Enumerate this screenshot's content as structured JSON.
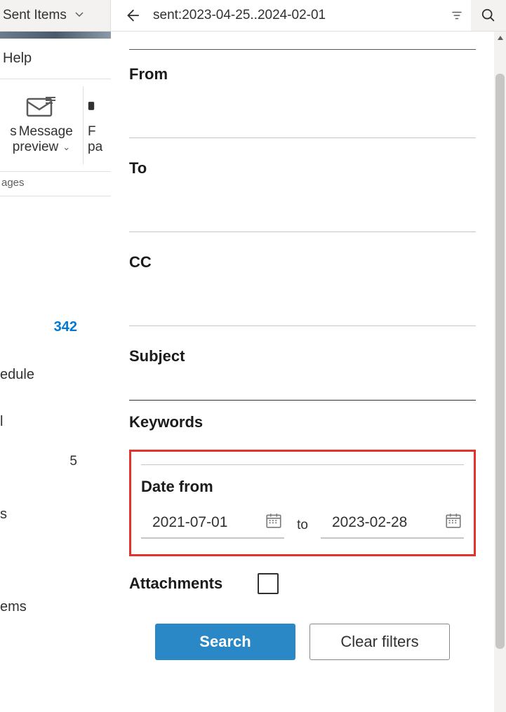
{
  "topbar": {
    "folder_label": "Sent Items",
    "search_query": "sent:2023-04-25..2024-02-01"
  },
  "help_label": "Help",
  "ribbon": {
    "msg_preview_prefix": "s",
    "msg_preview_line1": "Message",
    "msg_preview_line2": "preview",
    "folder_pane_prefix": "F",
    "folder_pane_line2": "pa",
    "group_label": "ages"
  },
  "left_items": {
    "count1": "342",
    "item_schedule": "edule",
    "item_l": "l",
    "count_drafts": "5",
    "item_s": "s",
    "item_ems": "ems"
  },
  "panel": {
    "from_label": "From",
    "to_label": "To",
    "cc_label": "CC",
    "subject_label": "Subject",
    "keywords_label": "Keywords",
    "date_from_label": "Date from",
    "date_from_value": "2021-07-01",
    "date_to_word": "to",
    "date_to_value": "2023-02-28",
    "attachments_label": "Attachments",
    "search_btn": "Search",
    "clear_btn": "Clear filters"
  }
}
